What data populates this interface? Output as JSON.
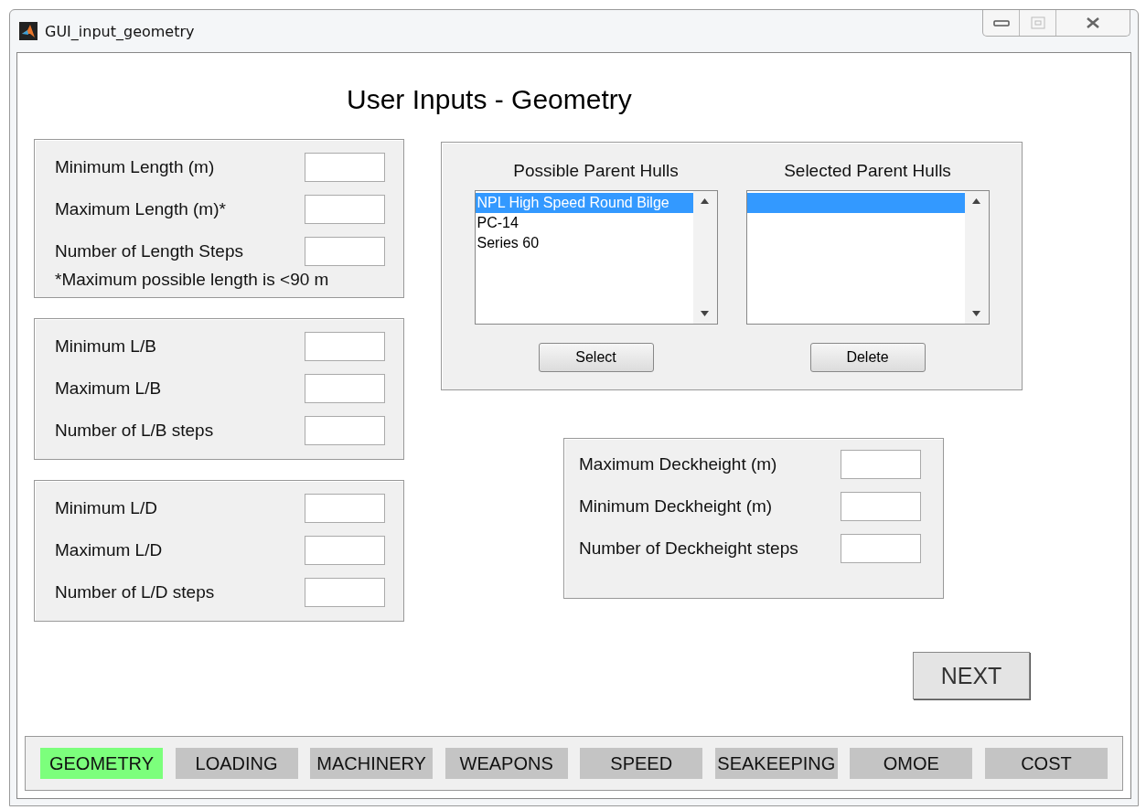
{
  "window": {
    "title": "GUI_input_geometry"
  },
  "heading": "User Inputs - Geometry",
  "left_panels": [
    {
      "fields": [
        {
          "label": "Minimum Length (m)"
        },
        {
          "label": "Maximum Length (m)*"
        },
        {
          "label": "Number of Length Steps"
        }
      ],
      "note": "*Maximum possible length is <90 m"
    },
    {
      "fields": [
        {
          "label": "Minimum L/B"
        },
        {
          "label": "Maximum L/B"
        },
        {
          "label": "Number of L/B steps"
        }
      ]
    },
    {
      "fields": [
        {
          "label": "Minimum L/D"
        },
        {
          "label": "Maximum L/D"
        },
        {
          "label": "Number of L/D steps"
        }
      ]
    }
  ],
  "hulls": {
    "possible": {
      "title": "Possible Parent Hulls",
      "items": [
        {
          "label": "NPL High Speed Round Bilge",
          "selected": true
        },
        {
          "label": "PC-14",
          "selected": false
        },
        {
          "label": "Series 60",
          "selected": false
        }
      ],
      "button": "Select"
    },
    "chosen": {
      "title": "Selected Parent Hulls",
      "empty_row_highlighted": true,
      "button": "Delete"
    }
  },
  "deckheight": {
    "fields": [
      {
        "label": "Maximum Deckheight (m)"
      },
      {
        "label": "Minimum Deckheight (m)"
      },
      {
        "label": "Number of Deckheight steps"
      }
    ]
  },
  "next_button": "NEXT",
  "tabs": [
    {
      "label": "GEOMETRY",
      "selected": true
    },
    {
      "label": "LOADING",
      "selected": false
    },
    {
      "label": "MACHINERY",
      "selected": false
    },
    {
      "label": "WEAPONS",
      "selected": false
    },
    {
      "label": "SPEED",
      "selected": false
    },
    {
      "label": "SEAKEEPING",
      "selected": false
    },
    {
      "label": "OMOE",
      "selected": false
    },
    {
      "label": "COST",
      "selected": false
    }
  ]
}
